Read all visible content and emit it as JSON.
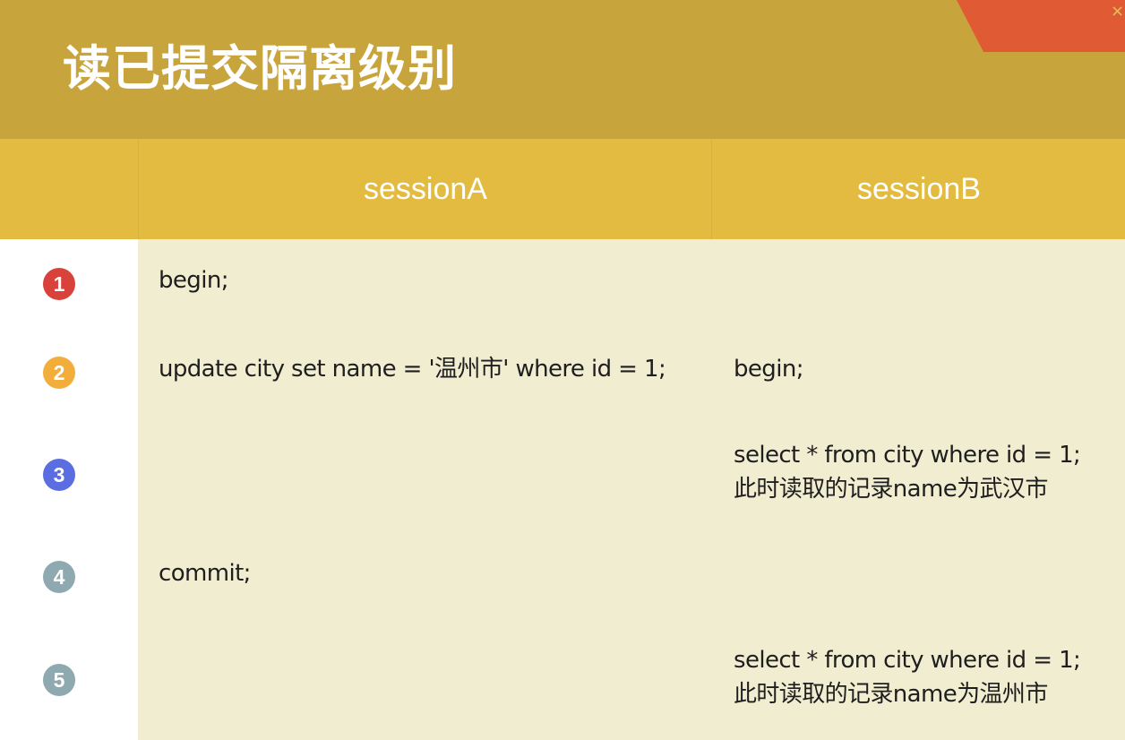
{
  "title": "读已提交隔离级别",
  "close_glyph": "×",
  "columns": {
    "step": "",
    "a": "sessionA",
    "b": "sessionB"
  },
  "rows": [
    {
      "num": "1",
      "color": "#d9423a",
      "a": "begin;",
      "b1": "",
      "b2": ""
    },
    {
      "num": "2",
      "color": "#f2ad3a",
      "a": "update city set name = '温州市' where id = 1;",
      "b1": "begin;",
      "b2": ""
    },
    {
      "num": "3",
      "color": "#5b6ee1",
      "a": "",
      "b1": "select * from city where id = 1;",
      "b2": "此时读取的记录name为武汉市"
    },
    {
      "num": "4",
      "color": "#8fa9b0",
      "a": "commit;",
      "b1": "",
      "b2": ""
    },
    {
      "num": "5",
      "color": "#8fa9b0",
      "a": "",
      "b1": "select * from city where id = 1;",
      "b2": "此时读取的记录name为温州市"
    }
  ],
  "colors": {
    "header_bg": "#c8a53c",
    "column_header_bg": "#e3bb40",
    "content_bg": "#f1edd1",
    "corner_accent": "#e05b33"
  }
}
